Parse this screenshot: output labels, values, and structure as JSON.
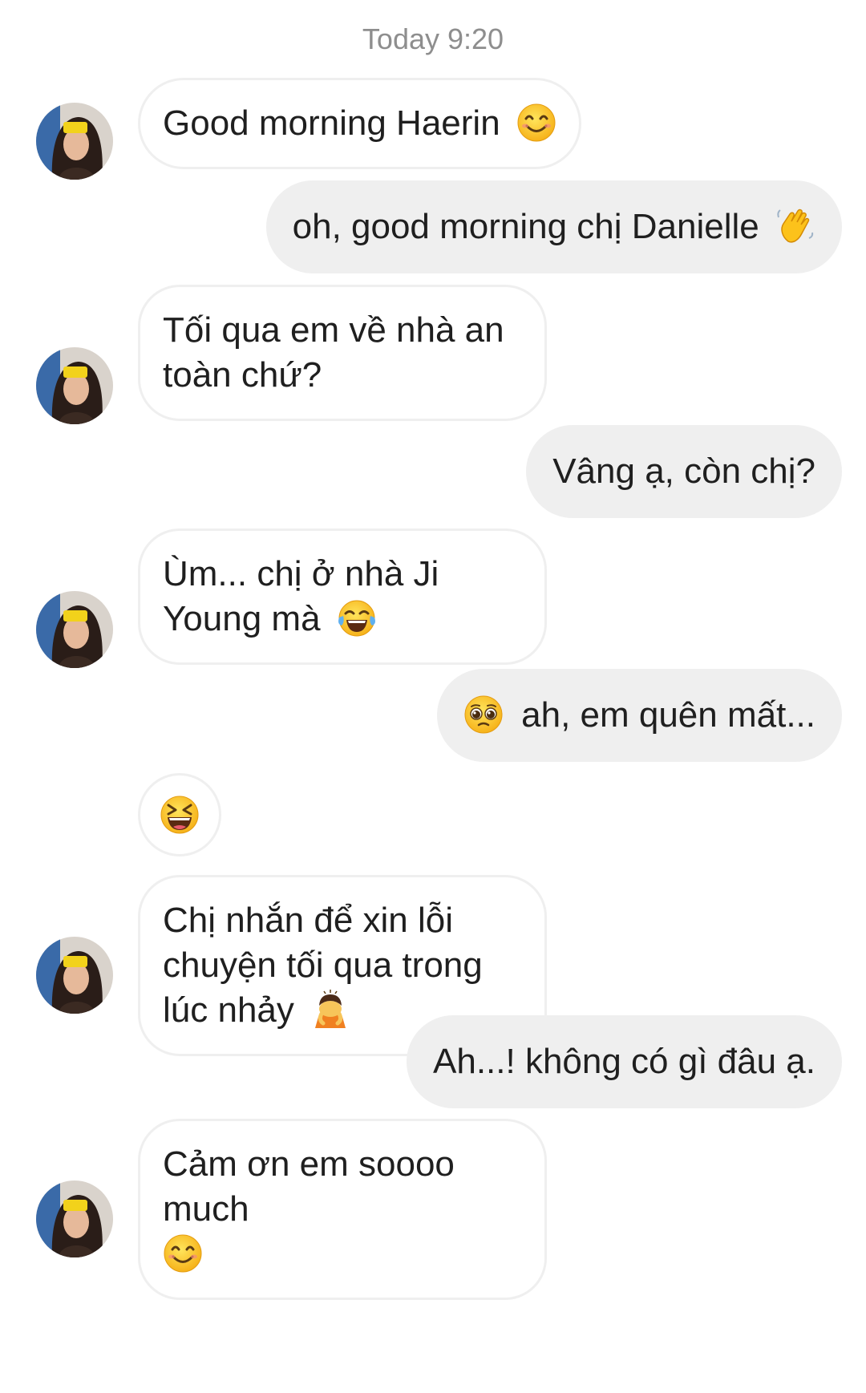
{
  "header": {
    "timestamp": "Today 9:20"
  },
  "messages": [
    {
      "text": "Good morning Haerin",
      "emoji": "smiling-face-icon"
    },
    {
      "text": "oh, good morning chị Danielle",
      "emoji": "waving-hand-icon"
    },
    {
      "text": "Tối qua em về nhà an toàn chứ?"
    },
    {
      "text": "Vâng ạ, còn chị?"
    },
    {
      "text": "Ùm... chị ở nhà Ji Young mà",
      "emoji": "tears-of-joy-icon"
    },
    {
      "text": "ah, em quên mất...",
      "emoji": "pleading-face-icon"
    },
    {
      "text": "",
      "emoji": "squinting-laughing-face-icon"
    },
    {
      "text": "Chị nhắn để xin lỗi chuyện tối qua trong lúc nhảy",
      "emoji": "person-bowing-icon"
    },
    {
      "text": "Ah...! không có gì đâu ạ."
    },
    {
      "text": "Cảm ơn em soooo much",
      "emoji": "smiling-face-icon"
    }
  ],
  "colors": {
    "incoming_bg": "#ffffff",
    "incoming_border": "#efefef",
    "outgoing_bg": "#efefef",
    "text": "#1f1f1f",
    "timestamp": "#8e8e8e"
  }
}
